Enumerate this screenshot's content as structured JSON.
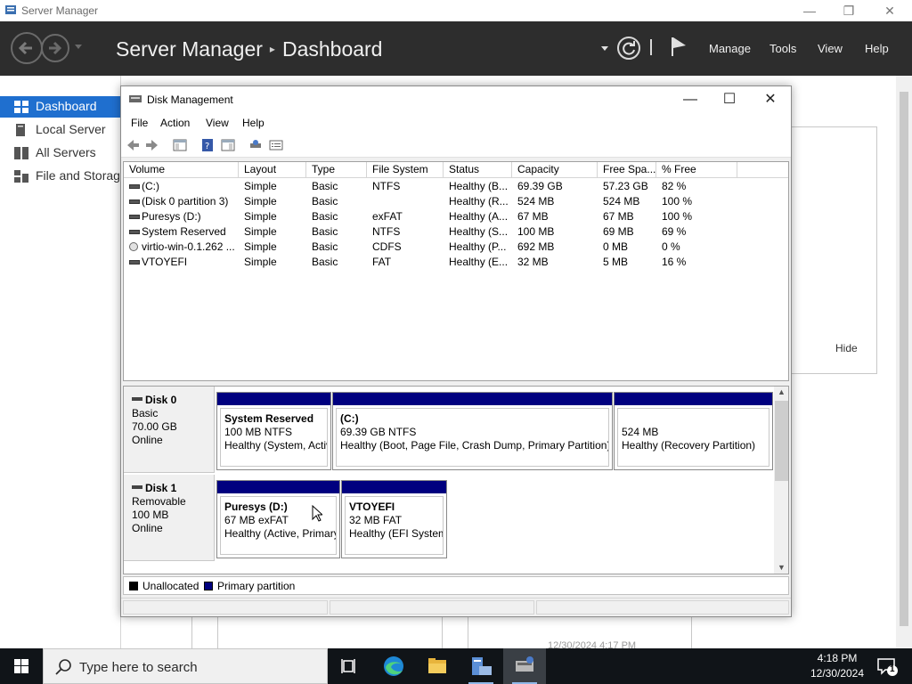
{
  "server_manager": {
    "window_title": "Server Manager",
    "breadcrumb_root": "Server Manager",
    "breadcrumb_sep": "▸",
    "breadcrumb_current": "Dashboard",
    "menu": {
      "manage": "Manage",
      "tools": "Tools",
      "view": "View",
      "help": "Help"
    },
    "sidebar": [
      {
        "label": "Dashboard",
        "active": true
      },
      {
        "label": "Local Server"
      },
      {
        "label": "All Servers"
      },
      {
        "label": "File and Storage Services"
      }
    ],
    "hide_label": "Hide",
    "background_timestamp": "12/30/2024 4:17 PM"
  },
  "disk_management": {
    "title": "Disk Management",
    "menu": {
      "file": "File",
      "action": "Action",
      "view": "View",
      "help": "Help"
    },
    "columns": [
      "Volume",
      "Layout",
      "Type",
      "File System",
      "Status",
      "Capacity",
      "Free Spa...",
      "% Free"
    ],
    "volumes": [
      {
        "volume": " (C:)",
        "layout": "Simple",
        "type": "Basic",
        "fs": "NTFS",
        "status": "Healthy (B...",
        "capacity": "69.39 GB",
        "free": "57.23 GB",
        "pct": "82 %",
        "icon": "drive"
      },
      {
        "volume": "(Disk 0 partition 3)",
        "layout": "Simple",
        "type": "Basic",
        "fs": "",
        "status": "Healthy (R...",
        "capacity": "524 MB",
        "free": "524 MB",
        "pct": "100 %",
        "icon": "drive"
      },
      {
        "volume": "Puresys (D:)",
        "layout": "Simple",
        "type": "Basic",
        "fs": "exFAT",
        "status": "Healthy (A...",
        "capacity": "67 MB",
        "free": "67 MB",
        "pct": "100 %",
        "icon": "drive"
      },
      {
        "volume": "System Reserved",
        "layout": "Simple",
        "type": "Basic",
        "fs": "NTFS",
        "status": "Healthy (S...",
        "capacity": "100 MB",
        "free": "69 MB",
        "pct": "69 %",
        "icon": "drive"
      },
      {
        "volume": "virtio-win-0.1.262 ...",
        "layout": "Simple",
        "type": "Basic",
        "fs": "CDFS",
        "status": "Healthy (P...",
        "capacity": "692 MB",
        "free": "0 MB",
        "pct": "0 %",
        "icon": "cd"
      },
      {
        "volume": "VTOYEFI",
        "layout": "Simple",
        "type": "Basic",
        "fs": "FAT",
        "status": "Healthy (E...",
        "capacity": "32 MB",
        "free": "5 MB",
        "pct": "16 %",
        "icon": "drive"
      }
    ],
    "disks": [
      {
        "name": "Disk 0",
        "kind": "Basic",
        "size": "70.00 GB",
        "state": "Online",
        "partitions": [
          {
            "name": "System Reserved",
            "size": "100 MB NTFS",
            "status": "Healthy (System, Active, Primary Partition)"
          },
          {
            "name": "(C:)",
            "size": "69.39 GB NTFS",
            "status": "Healthy (Boot, Page File, Crash Dump, Primary Partition)"
          },
          {
            "name": "",
            "size": "524 MB",
            "status": "Healthy (Recovery Partition)"
          }
        ]
      },
      {
        "name": "Disk 1",
        "kind": "Removable",
        "size": "100 MB",
        "state": "Online",
        "partitions": [
          {
            "name": "Puresys  (D:)",
            "size": "67 MB exFAT",
            "status": "Healthy (Active, Primary Partition)"
          },
          {
            "name": "VTOYEFI",
            "size": "32 MB FAT",
            "status": "Healthy (EFI System Partition)"
          }
        ]
      }
    ],
    "legend": [
      {
        "label": "Unallocated",
        "color": "#000000"
      },
      {
        "label": "Primary partition",
        "color": "#00007f"
      }
    ]
  },
  "taskbar": {
    "search_placeholder": "Type here to search",
    "time": "4:18 PM",
    "date": "12/30/2024",
    "notification_count": "1"
  },
  "colors": {
    "accent": "#1f6fcf",
    "header_bg": "#2d2d2d",
    "primary_partition": "#00007f",
    "taskbar_bg": "#101418"
  }
}
